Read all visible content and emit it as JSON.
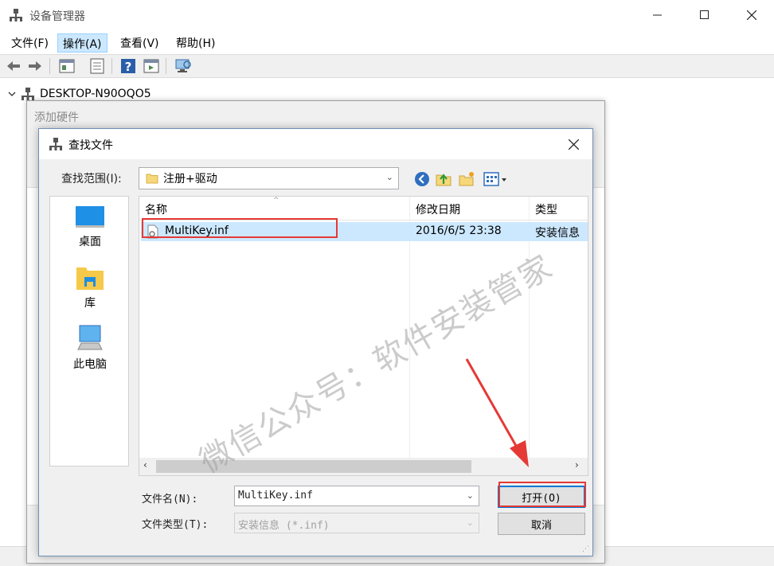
{
  "main_window": {
    "title": "设备管理器",
    "menu": [
      "文件(F)",
      "操作(A)",
      "查看(V)",
      "帮助(H)"
    ],
    "active_menu_index": 1,
    "toolbar_icons": [
      "back-icon",
      "forward-icon",
      "properties-icon",
      "update-icon",
      "help-icon",
      "show-hidden-icon",
      "scan-hardware-icon"
    ],
    "tree_root": "DESKTOP-N90OQO5"
  },
  "wizard": {
    "title": "添加硬件"
  },
  "dialog": {
    "title": "查找文件",
    "lookin_label": "查找范围(I):",
    "lookin_value": "注册+驱动",
    "nav_icons": [
      "back-icon",
      "up-folder-icon",
      "new-folder-icon",
      "view-menu-icon"
    ],
    "places": [
      {
        "label": "桌面",
        "icon": "desktop-icon"
      },
      {
        "label": "库",
        "icon": "library-icon"
      },
      {
        "label": "此电脑",
        "icon": "this-pc-icon"
      }
    ],
    "columns": [
      "名称",
      "修改日期",
      "类型"
    ],
    "files": [
      {
        "name": "MultiKey.inf",
        "modified": "2016/6/5 23:38",
        "type": "安装信息"
      }
    ],
    "filename_label": "文件名(N):",
    "filename_value": "MultiKey.inf",
    "filetype_label": "文件类型(T):",
    "filetype_value": "安装信息 (*.inf)",
    "open_button": "打开(O)",
    "cancel_button": "取消"
  },
  "watermark": "微信公众号：软件安装管家",
  "colors": {
    "selection": "#cce8ff",
    "highlight_box": "#e53935",
    "arrow": "#e53935"
  }
}
